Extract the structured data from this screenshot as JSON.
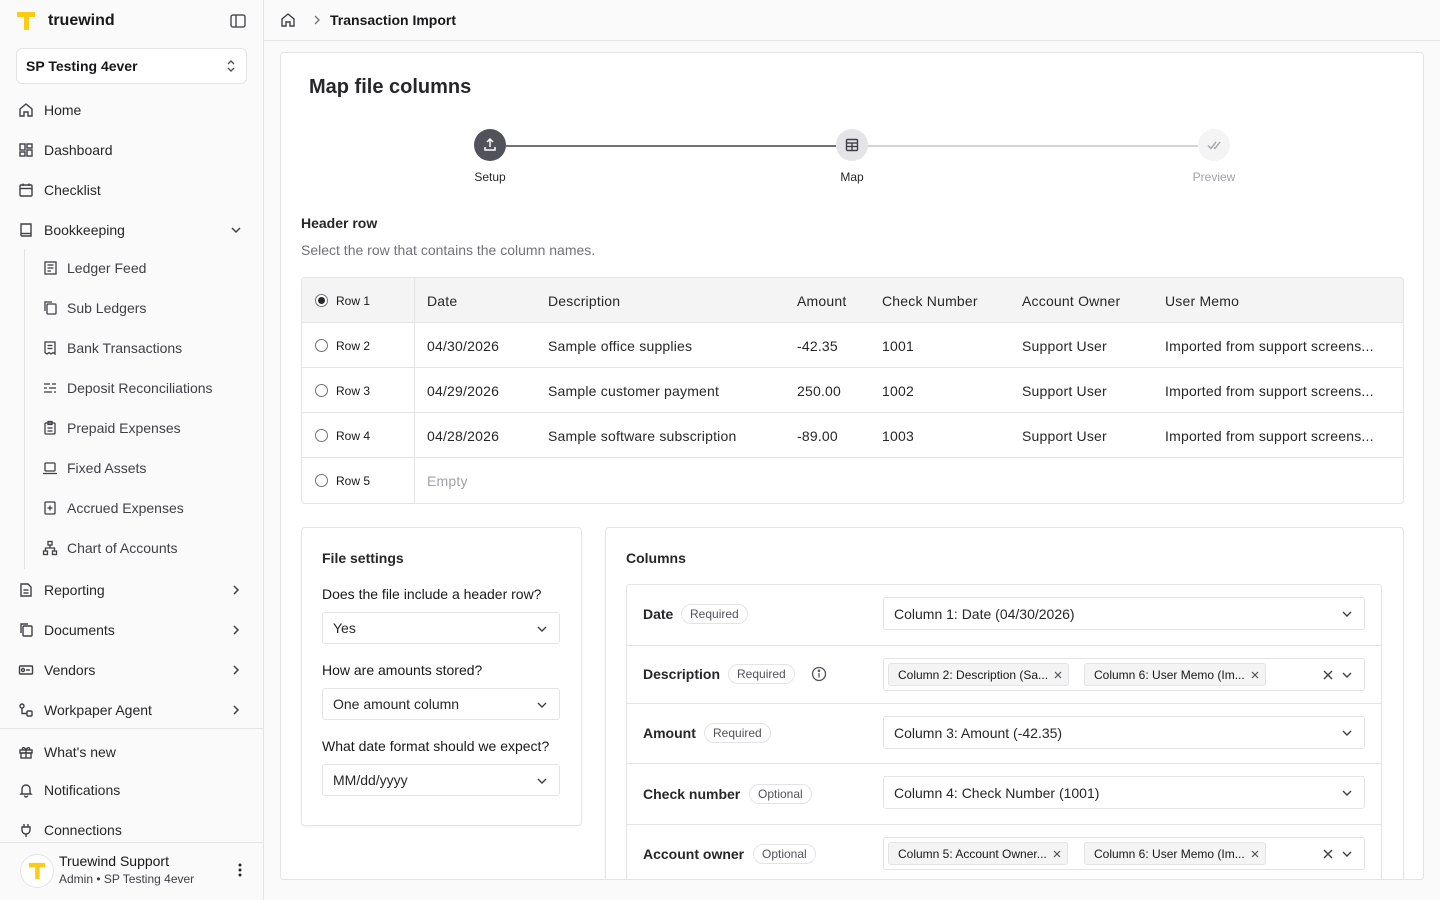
{
  "app": {
    "name": "truewind",
    "brand_color": "#facc15"
  },
  "org_switcher": {
    "value": "SP Testing 4ever"
  },
  "nav": {
    "home": "Home",
    "dashboard": "Dashboard",
    "checklist": "Checklist",
    "bookkeeping": "Bookkeeping",
    "bookkeeping_items": [
      "Ledger Feed",
      "Sub Ledgers",
      "Bank Transactions",
      "Deposit Reconciliations",
      "Prepaid Expenses",
      "Fixed Assets",
      "Accrued Expenses",
      "Chart of Accounts"
    ],
    "reporting": "Reporting",
    "documents": "Documents",
    "vendors": "Vendors",
    "workpaper_agent": "Workpaper Agent",
    "whats_new": "What's new",
    "notifications": "Notifications",
    "connections": "Connections"
  },
  "user": {
    "name": "Truewind Support",
    "role": "Admin • SP Testing 4ever"
  },
  "breadcrumb": {
    "current": "Transaction Import"
  },
  "page": {
    "title": "Map file columns"
  },
  "stepper": {
    "steps": [
      {
        "label": "Setup",
        "state": "complete"
      },
      {
        "label": "Map",
        "state": "current"
      },
      {
        "label": "Preview",
        "state": "upcoming"
      }
    ]
  },
  "header_row": {
    "title": "Header row",
    "subtitle": "Select the row that contains the column names.",
    "selected_row": "Row 1",
    "rows": [
      {
        "label": "Row 1",
        "selected": true,
        "cells": [
          "Date",
          "Description",
          "Amount",
          "Check Number",
          "Account Owner",
          "User Memo"
        ]
      },
      {
        "label": "Row 2",
        "selected": false,
        "cells": [
          "04/30/2026",
          "Sample office supplies",
          "-42.35",
          "1001",
          "Support User",
          "Imported from support screens..."
        ]
      },
      {
        "label": "Row 3",
        "selected": false,
        "cells": [
          "04/29/2026",
          "Sample customer payment",
          "250.00",
          "1002",
          "Support User",
          "Imported from support screens..."
        ]
      },
      {
        "label": "Row 4",
        "selected": false,
        "cells": [
          "04/28/2026",
          "Sample software subscription",
          "-89.00",
          "1003",
          "Support User",
          "Imported from support screens..."
        ]
      },
      {
        "label": "Row 5",
        "selected": false,
        "cells": [
          "Empty"
        ]
      }
    ]
  },
  "file_settings": {
    "title": "File settings",
    "header_question": "Does the file include a header row?",
    "header_value": "Yes",
    "amounts_question": "How are amounts stored?",
    "amounts_value": "One amount column",
    "date_question": "What date format should we expect?",
    "date_value": "MM/dd/yyyy"
  },
  "columns": {
    "title": "Columns",
    "rows": [
      {
        "name": "Date",
        "badge": "Required",
        "value": "Column 1: Date (04/30/2026)"
      },
      {
        "name": "Description",
        "badge": "Required",
        "chips": [
          "Column 2: Description (Sa...",
          "Column 6: User Memo (Im..."
        ]
      },
      {
        "name": "Amount",
        "badge": "Required",
        "value": "Column 3: Amount (-42.35)"
      },
      {
        "name": "Check number",
        "badge": "Optional",
        "value": "Column 4: Check Number (1001)"
      },
      {
        "name": "Account owner",
        "badge": "Optional",
        "chips": [
          "Column 5: Account Owner...",
          "Column 6: User Memo (Im..."
        ]
      }
    ]
  }
}
